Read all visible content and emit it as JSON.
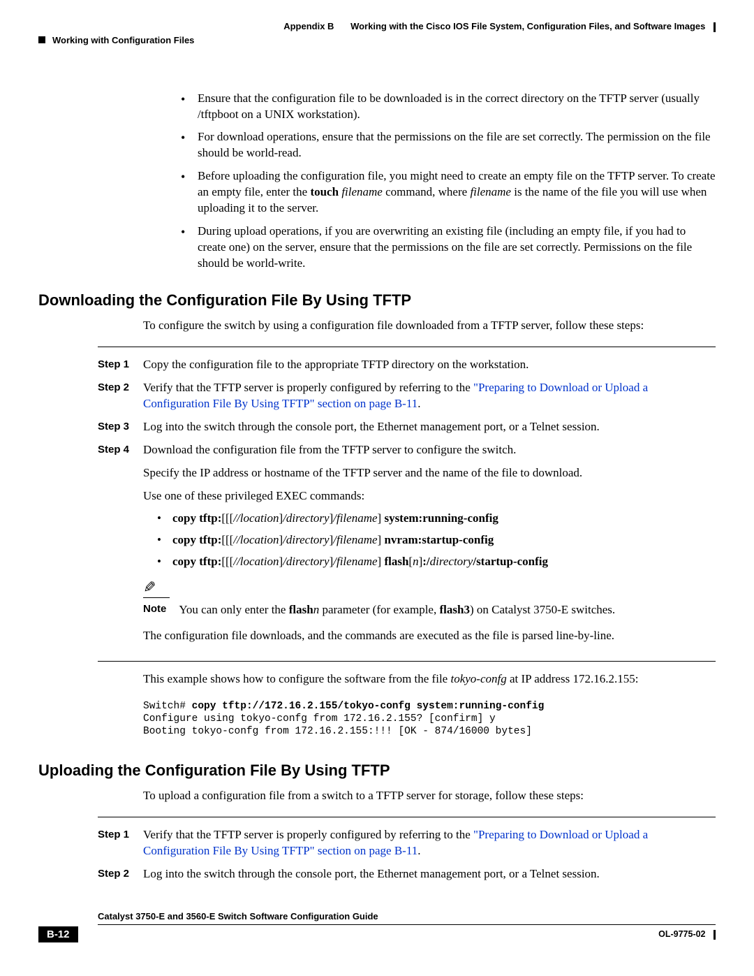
{
  "header": {
    "appendix": "Appendix B",
    "appendix_title": "Working with the Cisco IOS File System, Configuration Files, and Software Images",
    "section": "Working with Configuration Files"
  },
  "top_bullets": [
    "Ensure that the configuration file to be downloaded is in the correct directory on the TFTP server (usually /tftpboot on a UNIX workstation).",
    "For download operations, ensure that the permissions on the file are set correctly. The permission on the file should be world-read.",
    {
      "pre": "Before uploading the configuration file, you might need to create an empty file on the TFTP server. To create an empty file, enter the ",
      "b1": "touch",
      "mid1": " ",
      "i1": "filename",
      "mid2": " command, where ",
      "i2": "filename",
      "post": " is the name of the file you will use when uploading it to the server."
    },
    "During upload operations, if you are overwriting an existing file (including an empty file, if you had to create one) on the server, ensure that the permissions on the file are set correctly. Permissions on the file should be world-write."
  ],
  "section_download": {
    "heading": "Downloading the Configuration File By Using TFTP",
    "intro": "To configure the switch by using a configuration file downloaded from a TFTP server, follow these steps:",
    "steps": {
      "s1_label": "Step 1",
      "s1_text": "Copy the configuration file to the appropriate TFTP directory on the workstation.",
      "s2_label": "Step 2",
      "s2_pre": "Verify that the TFTP server is properly configured by referring to the ",
      "s2_link": "\"Preparing to Download or Upload a Configuration File By Using TFTP\" section on page B-11",
      "s2_post": ".",
      "s3_label": "Step 3",
      "s3_text": "Log into the switch through the console port, the Ethernet management port, or a Telnet session.",
      "s4_label": "Step 4",
      "s4_p1": "Download the configuration file from the TFTP server to configure the switch.",
      "s4_p2": "Specify the IP address or hostname of the TFTP server and the name of the file to download.",
      "s4_p3": "Use one of these privileged EXEC commands:"
    },
    "cmds": {
      "c1": {
        "b1": "copy tftp:",
        "t1": "[[[",
        "i1": "//location",
        "t2": "]",
        "i2": "/directory",
        "t3": "]",
        "i3": "/filename",
        "t4": "] ",
        "b2": "system:running-config"
      },
      "c2": {
        "b1": "copy tftp:",
        "t1": "[[[",
        "i1": "//location",
        "t2": "]",
        "i2": "/directory",
        "t3": "]",
        "i3": "/filename",
        "t4": "] ",
        "b2": "nvram:startup-config"
      },
      "c3": {
        "b1": "copy tftp:",
        "t1": "[[[",
        "i1": "//location",
        "t2": "]",
        "i2": "/directory",
        "t3": "]",
        "i3": "/filename",
        "t4": "] ",
        "b2": "flash",
        "t5": "[",
        "i4": "n",
        "t6": "]",
        "b3": ":/",
        "i5": "directory",
        "b4": "/startup-config"
      }
    },
    "note_label": "Note",
    "note": {
      "pre": "You can only enter the ",
      "b1": "flash",
      "i1": "n",
      "mid": " parameter (for example, ",
      "b2": "flash3",
      "post": ") on Catalyst 3750-E switches."
    },
    "after_note": "The configuration file downloads, and the commands are executed as the file is parsed line-by-line.",
    "example_intro_pre": "This example shows how to configure the software from the file ",
    "example_intro_i": "tokyo-confg",
    "example_intro_post": " at IP address 172.16.2.155:",
    "code_prompt": "Switch# ",
    "code_cmd": "copy tftp://172.16.2.155/tokyo-confg system:running-config",
    "code_out1": "Configure using tokyo-confg from 172.16.2.155? [confirm] y",
    "code_out2": "Booting tokyo-confg from 172.16.2.155:!!! [OK - 874/16000 bytes]"
  },
  "section_upload": {
    "heading": "Uploading the Configuration File By Using TFTP",
    "intro": "To upload a configuration file from a switch to a TFTP server for storage, follow these steps:",
    "steps": {
      "s1_label": "Step 1",
      "s1_pre": "Verify that the TFTP server is properly configured by referring to the ",
      "s1_link": "\"Preparing to Download or Upload a Configuration File By Using TFTP\" section on page B-11",
      "s1_post": ".",
      "s2_label": "Step 2",
      "s2_text": "Log into the switch through the console port, the Ethernet management port, or a Telnet session."
    }
  },
  "footer": {
    "guide": "Catalyst 3750-E and 3560-E Switch Software Configuration Guide",
    "pagenum": "B-12",
    "docid": "OL-9775-02"
  }
}
